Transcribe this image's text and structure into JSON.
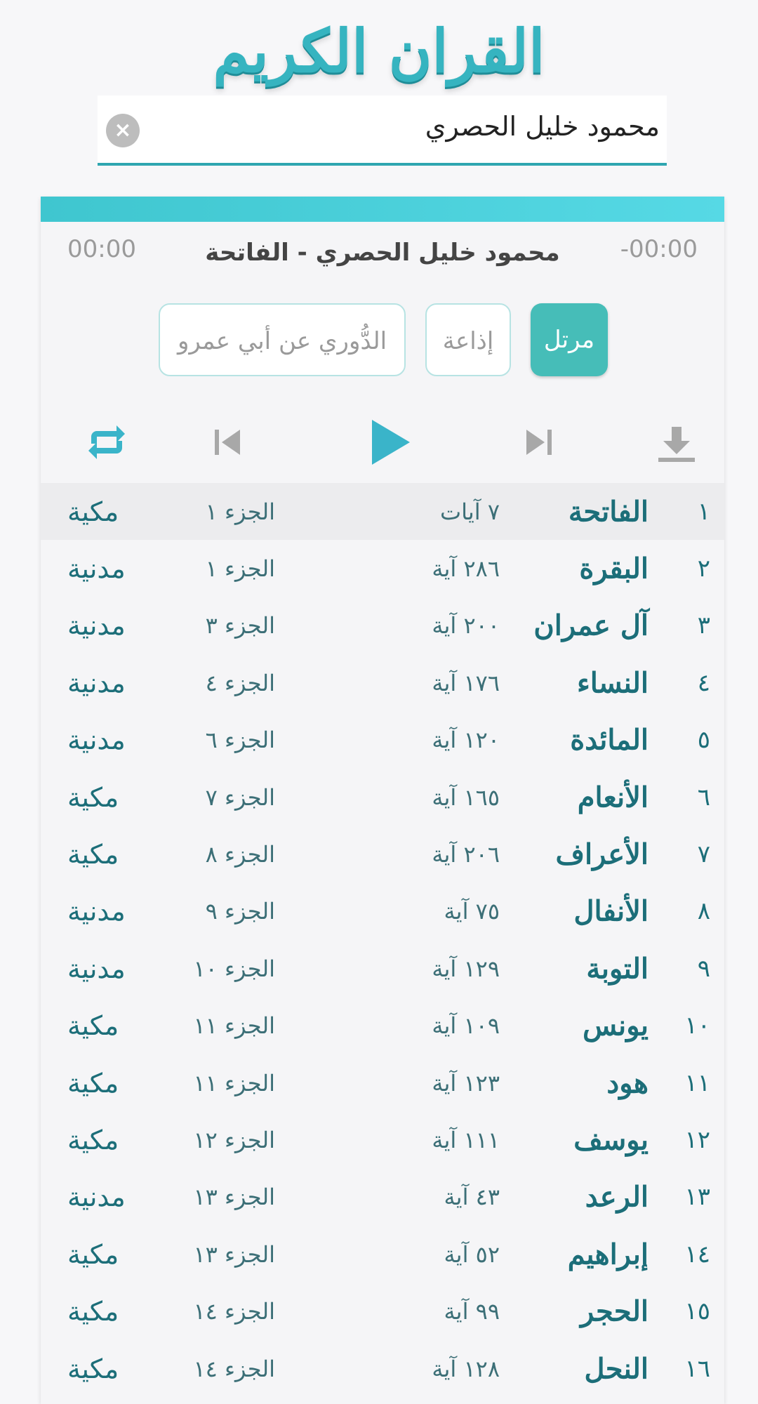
{
  "app": {
    "title": "القران الكريم"
  },
  "search": {
    "value": "محمود خليل الحصري",
    "clear_icon": "×"
  },
  "player": {
    "time_remaining": "-00:00",
    "time_elapsed": "00:00",
    "track_title": "محمود خليل الحصري - الفاتحة",
    "modes": {
      "murattal": "مرتل",
      "radio": "إذاعة",
      "narration": "الدُّوري عن أبي عمرو"
    },
    "icons": {
      "download": "download-icon",
      "next": "skip-next-icon",
      "play": "play-icon",
      "previous": "skip-previous-icon",
      "repeat": "repeat-icon"
    },
    "accent_color": "#46bdb8"
  },
  "surahs": [
    {
      "num": "١",
      "name": "الفاتحة",
      "ayat": "٧ آيات",
      "juz": "الجزء ١",
      "type": "مكية"
    },
    {
      "num": "٢",
      "name": "البقرة",
      "ayat": "٢٨٦ آية",
      "juz": "الجزء ١",
      "type": "مدنية"
    },
    {
      "num": "٣",
      "name": "آل عمران",
      "ayat": "٢٠٠ آية",
      "juz": "الجزء ٣",
      "type": "مدنية"
    },
    {
      "num": "٤",
      "name": "النساء",
      "ayat": "١٧٦ آية",
      "juz": "الجزء ٤",
      "type": "مدنية"
    },
    {
      "num": "٥",
      "name": "المائدة",
      "ayat": "١٢٠ آية",
      "juz": "الجزء ٦",
      "type": "مدنية"
    },
    {
      "num": "٦",
      "name": "الأنعام",
      "ayat": "١٦٥ آية",
      "juz": "الجزء ٧",
      "type": "مكية"
    },
    {
      "num": "٧",
      "name": "الأعراف",
      "ayat": "٢٠٦ آية",
      "juz": "الجزء ٨",
      "type": "مكية"
    },
    {
      "num": "٨",
      "name": "الأنفال",
      "ayat": "٧٥ آية",
      "juz": "الجزء ٩",
      "type": "مدنية"
    },
    {
      "num": "٩",
      "name": "التوبة",
      "ayat": "١٢٩ آية",
      "juz": "الجزء ١٠",
      "type": "مدنية"
    },
    {
      "num": "١٠",
      "name": "يونس",
      "ayat": "١٠٩ آية",
      "juz": "الجزء ١١",
      "type": "مكية"
    },
    {
      "num": "١١",
      "name": "هود",
      "ayat": "١٢٣ آية",
      "juz": "الجزء ١١",
      "type": "مكية"
    },
    {
      "num": "١٢",
      "name": "يوسف",
      "ayat": "١١١ آية",
      "juz": "الجزء ١٢",
      "type": "مكية"
    },
    {
      "num": "١٣",
      "name": "الرعد",
      "ayat": "٤٣ آية",
      "juz": "الجزء ١٣",
      "type": "مدنية"
    },
    {
      "num": "١٤",
      "name": "إبراهيم",
      "ayat": "٥٢ آية",
      "juz": "الجزء ١٣",
      "type": "مكية"
    },
    {
      "num": "١٥",
      "name": "الحجر",
      "ayat": "٩٩ آية",
      "juz": "الجزء ١٤",
      "type": "مكية"
    },
    {
      "num": "١٦",
      "name": "النحل",
      "ayat": "١٢٨ آية",
      "juz": "الجزء ١٤",
      "type": "مكية"
    }
  ]
}
